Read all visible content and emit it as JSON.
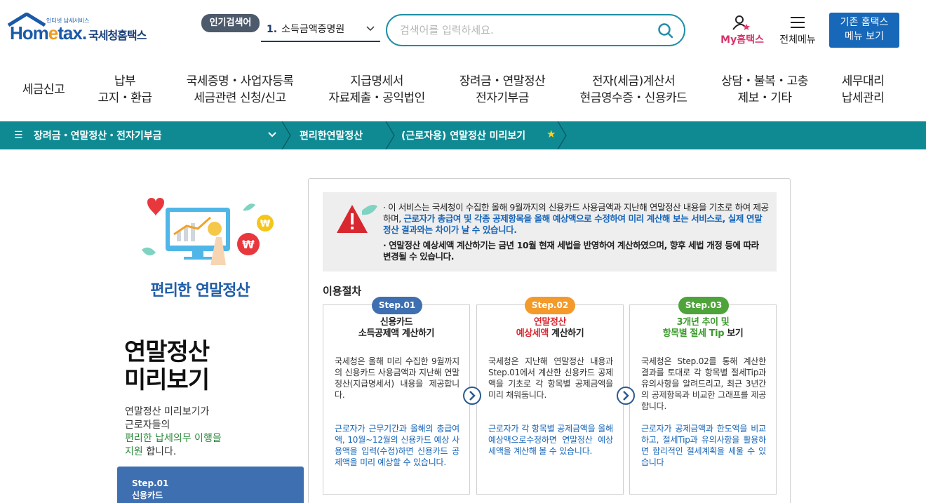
{
  "header": {
    "logo_brand_pre": "Hom",
    "logo_brand_e": "e",
    "logo_brand_post": "tax.",
    "logo_tagline": "인터넷 납세서비스",
    "logo_kor": "국세청홈택스",
    "popular_badge": "인기검색어",
    "popular_num": "1.",
    "popular_term": "소득금액증명원",
    "search_placeholder": "검색어를 입력하세요.",
    "my_home": "My홈택스",
    "all_menu": "전체메뉴",
    "old_menu_line1": "기존 홈택스",
    "old_menu_line2": "메뉴 보기"
  },
  "gnb": {
    "items": [
      {
        "l1": "세금신고",
        "l2": ""
      },
      {
        "l1": "납부",
        "l2": "고지・환급"
      },
      {
        "l1": "국세증명・사업자등록",
        "l2": "세금관련 신청/신고"
      },
      {
        "l1": "지급명세서",
        "l2": "자료제출・공익법인"
      },
      {
        "l1": "장려금・연말정산",
        "l2": "전자기부금"
      },
      {
        "l1": "전자(세금)계산서",
        "l2": "현금영수증・신용카드"
      },
      {
        "l1": "상담・불복・고충",
        "l2": "제보・기타"
      },
      {
        "l1": "세무대리",
        "l2": "납세관리"
      }
    ]
  },
  "breadcrumb": {
    "c1": "장려금・연말정산・전자기부금",
    "c2": "편리한연말정산",
    "c3": "(근로자용) 연말정산 미리보기"
  },
  "promo": {
    "title": "편리한 연말정산",
    "big_line1": "연말정산",
    "big_line2": "미리보기",
    "desc_line1": "연말정산 미리보기가",
    "desc_line2": "근로자들의",
    "desc_line3_green": "편리한 납세의무 이행을",
    "desc_line4_green": "지원",
    "desc_line4_rest": " 합니다.",
    "step_label": "Step.01",
    "step_title": "신용카드"
  },
  "notice": {
    "p1_a": "· 이 서비스는 국세청이 수집한 올해 9월까지의 신용카드 사용금액과 지난해 연말정산 내용을 기초로 하여",
    "p1_b": "제공하며, ",
    "p1_blue": "근로자가 총급여 및 각종 공제항목을 올해 예상액으로 수정하여 미리 계산해 보는 서비스로, 실제 연말정산 결과와는 차이가 날 수 있습니다.",
    "p2": "· 연말정산 예상세액 계산하기는 금년 10월 현재 세법을 반영하여 계산하였으며, 향후 세법 개정 등에 따라 변경될 수 있습니다."
  },
  "procedure": {
    "title": "이용절차",
    "steps": [
      {
        "badge": "Step.01",
        "title_l1": "신용카드",
        "title_l2": "소득공제액 계산하기",
        "body": "국세청은 올해 미리 수집한 9월까지의 신용카드 사용금액과 지난해 연말정산(지급명세서) 내용을 제공합니다.",
        "note": "근로자가 근무기간과 올해의 총급여액, 10월~12월의 신용카드 예상 사용액을 입력(수정)하면 신용카드 공제액을 미리 예상할 수 있습니다."
      },
      {
        "badge": "Step.02",
        "title_l1": "연말정산",
        "title_l2a": "예상세액",
        "title_l2b": " 계산하기",
        "body": "국세청은 지난해 연말정산 내용과 Step.01에서 계산한 신용카드 공제액을 기초로 각 항목별 공제금액을 미리 채워둡니다.",
        "note": "근로자가 각 항목별 공제금액을 올해예상액으로수정하면 연말정산 예상세액을 계산해 볼 수 있습니다."
      },
      {
        "badge": "Step.03",
        "title_l1": "3개년 추이 및",
        "title_l2a": "항목별 절세 Tip",
        "title_l2b": " 보기",
        "body": "국세청은 Step.02를 통해 계산한 결과를 토대로 각 항목별 절세Tip과 유의사항을 알려드리고, 최근 3년간의 공제항목과 비교한 그래프를 제공합니다.",
        "note": "근로자가 공제금액과 한도액을 비교하고, 절세Tip과 유의사항을 활용하면 합리적인 절세계획을 세울 수 있습니다"
      }
    ]
  },
  "colors": {
    "teal": "#0f8a93",
    "brand_blue": "#1a5aa8",
    "step1": "#3e6fb0",
    "step2": "#f39a2b",
    "step3": "#4ea43a"
  }
}
